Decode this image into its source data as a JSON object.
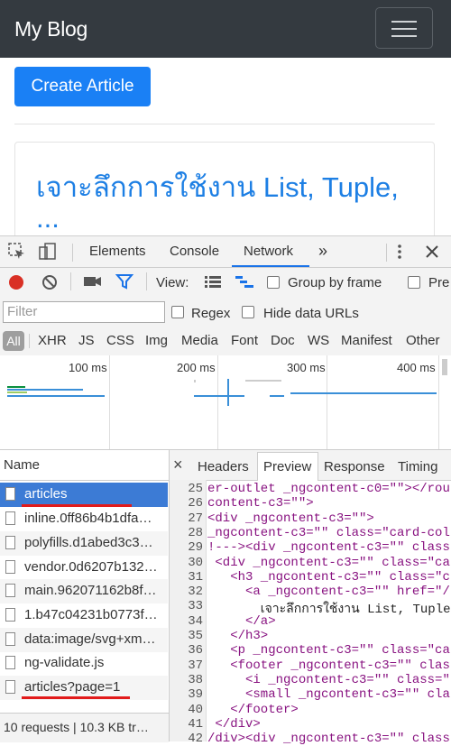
{
  "app": {
    "brand": "My Blog"
  },
  "page": {
    "create_button": "Create Article",
    "article_title": "เจาะลึกการใช้งาน List, Tuple,",
    "article_title_more": "..."
  },
  "devtools": {
    "tabs": [
      "Elements",
      "Console",
      "Network"
    ],
    "more_tabs": "»",
    "active_tab": "Network",
    "toolbar": {
      "view_label": "View:",
      "group_by_frame": "Group by frame",
      "preserve_log": "Pre"
    },
    "filter": {
      "placeholder": "Filter",
      "regex": "Regex",
      "hide_data_urls": "Hide data URLs"
    },
    "types": [
      "All",
      "XHR",
      "JS",
      "CSS",
      "Img",
      "Media",
      "Font",
      "Doc",
      "WS",
      "Manifest",
      "Other"
    ],
    "timeline_ticks": [
      "100 ms",
      "200 ms",
      "300 ms",
      "400 ms"
    ],
    "name_header": "Name",
    "requests": [
      "articles",
      "inline.0ff86b4b1dfa…",
      "polyfills.d1abed3c3…",
      "vendor.0d6207b132…",
      "main.962071162b8f…",
      "1.b47c04231b0773f…",
      "data:image/svg+xm…",
      "ng-validate.js",
      "articles?page=1"
    ],
    "status": "10 requests | 10.3 KB tr…",
    "detail_tabs": [
      "Headers",
      "Preview",
      "Response",
      "Timing"
    ],
    "active_detail_tab": "Preview",
    "close_symbol": "×",
    "code_lines": [
      {
        "n": "25",
        "t": "er-outlet _ngcontent-c0=\"\"></rou"
      },
      {
        "n": "26",
        "t": "content-c3=\"\">"
      },
      {
        "n": "27",
        "t": "<div _ngcontent-c3=\"\">"
      },
      {
        "n": "28",
        "t": "_ngcontent-c3=\"\" class=\"card-col"
      },
      {
        "n": "29",
        "t": "!---><div _ngcontent-c3=\"\" class"
      },
      {
        "n": "30",
        "t": " <div _ngcontent-c3=\"\" class=\"ca"
      },
      {
        "n": "31",
        "t": "   <h3 _ngcontent-c3=\"\" class=\"c"
      },
      {
        "n": "32",
        "t": "     <a _ngcontent-c3=\"\" href=\"/"
      },
      {
        "n": "33",
        "t": "       เจาะลึกการใช้งาน List, Tuple"
      },
      {
        "n": "34",
        "t": "     </a>"
      },
      {
        "n": "35",
        "t": "   </h3>"
      },
      {
        "n": "36",
        "t": "   <p _ngcontent-c3=\"\" class=\"ca"
      },
      {
        "n": "37",
        "t": "   <footer _ngcontent-c3=\"\" class"
      },
      {
        "n": "38",
        "t": "     <i _ngcontent-c3=\"\" class=\""
      },
      {
        "n": "39",
        "t": "     <small _ngcontent-c3=\"\" cla"
      },
      {
        "n": "40",
        "t": "   </footer>"
      },
      {
        "n": "41",
        "t": " </div>"
      },
      {
        "n": "42",
        "t": "/div><div _ngcontent-c3=\"\" class"
      }
    ]
  },
  "colors": {
    "accent": "#1a73e8",
    "primary_button": "#1a80f5",
    "record": "#d93025",
    "navbar": "#343a40",
    "highlight": "#e21b1b"
  }
}
